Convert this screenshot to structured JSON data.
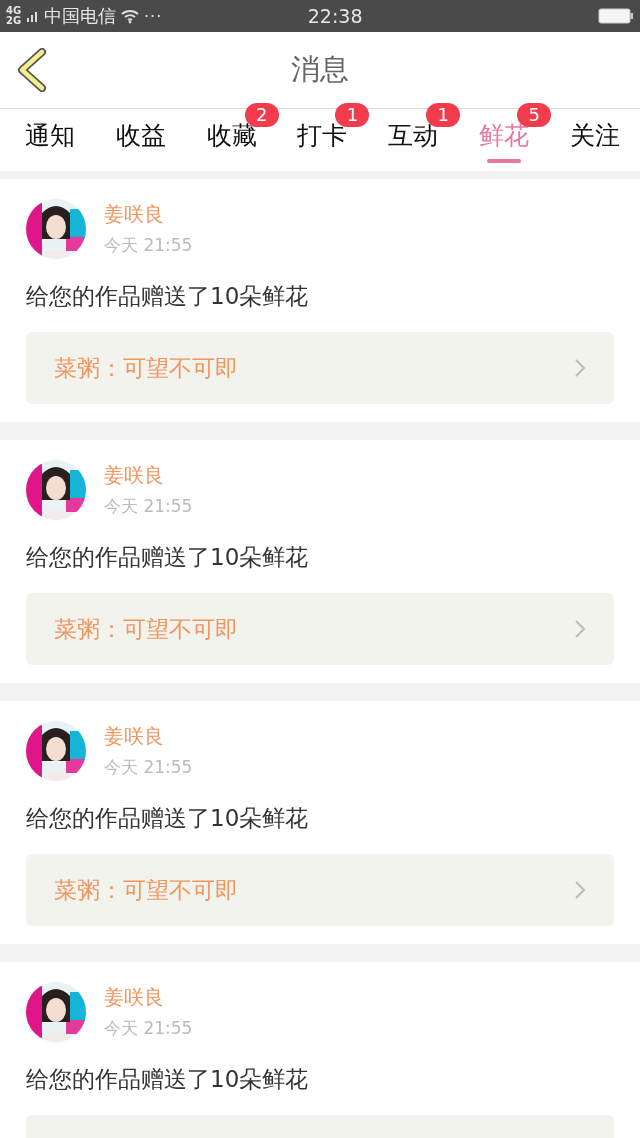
{
  "status_bar": {
    "network": "4G 2G",
    "carrier": "中国电信",
    "more": "···",
    "time": "22:38"
  },
  "header": {
    "title": "消息"
  },
  "tabs": [
    {
      "label": "通知",
      "selected": false
    },
    {
      "label": "收益",
      "selected": false
    },
    {
      "label": "收藏",
      "selected": false,
      "badge": "2"
    },
    {
      "label": "打卡",
      "selected": false,
      "badge": "1"
    },
    {
      "label": "互动",
      "selected": false,
      "badge": "1"
    },
    {
      "label": "鲜花",
      "selected": true,
      "badge": "5"
    },
    {
      "label": "关注",
      "selected": false
    }
  ],
  "messages": [
    {
      "name": "姜咲良",
      "time": "今天 21:55",
      "text": "给您的作品赠送了10朵鲜花",
      "work": "菜粥：可望不可即"
    },
    {
      "name": "姜咲良",
      "time": "今天 21:55",
      "text": "给您的作品赠送了10朵鲜花",
      "work": "菜粥：可望不可即"
    },
    {
      "name": "姜咲良",
      "time": "今天 21:55",
      "text": "给您的作品赠送了10朵鲜花",
      "work": "菜粥：可望不可即"
    },
    {
      "name": "姜咲良",
      "time": "今天 21:55",
      "text": "给您的作品赠送了10朵鲜花"
    }
  ]
}
